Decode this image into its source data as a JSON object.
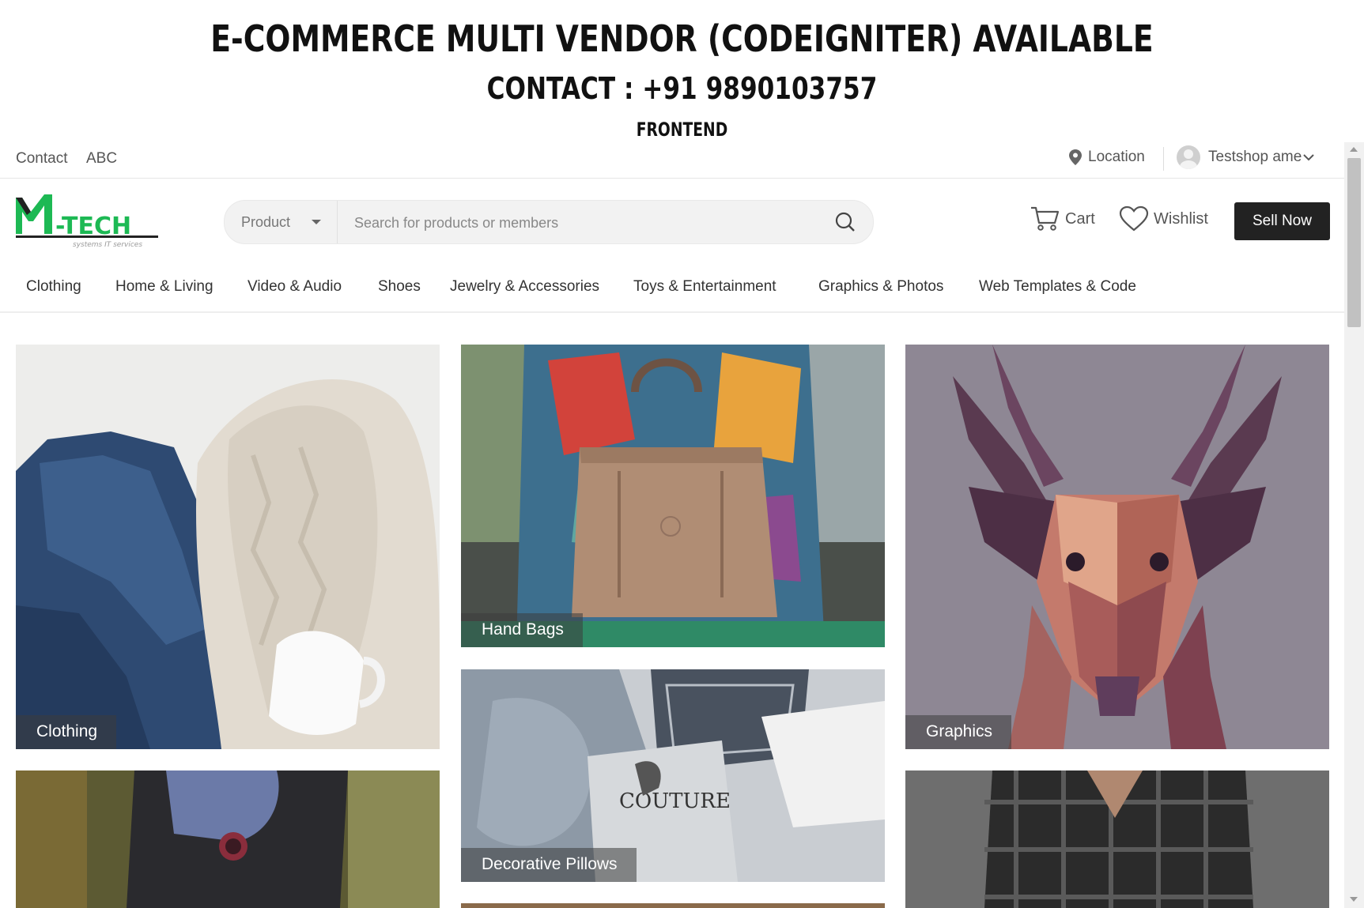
{
  "banner": {
    "title": "E-COMMERCE MULTI VENDOR (CODEIGNITER) AVAILABLE",
    "contact": "CONTACT : +91 9890103757",
    "subtitle": "FRONTEND"
  },
  "topbar": {
    "links": [
      "Contact",
      "ABC"
    ],
    "location_label": "Location",
    "user_name": "Testshop ame"
  },
  "header": {
    "logo_text": "-TECH",
    "logo_tagline": "systems IT services",
    "search_category": "Product",
    "search_placeholder": "Search for products or members",
    "cart_label": "Cart",
    "wishlist_label": "Wishlist",
    "sell_label": "Sell Now"
  },
  "nav": {
    "items": [
      "Clothing",
      "Home & Living",
      "Video & Audio",
      "Shoes",
      "Jewelry & Accessories",
      "Toys & Entertainment",
      "Graphics & Photos",
      "Web Templates & Code"
    ]
  },
  "tiles": [
    {
      "label": "Clothing",
      "icon": "sweater-jeans-photo"
    },
    {
      "label": "Hand Bags",
      "icon": "handbag-photo"
    },
    {
      "label": "Graphics",
      "icon": "polygon-deer-photo"
    },
    {
      "label": "Decorative Pillows",
      "icon": "pillow-photo"
    },
    {
      "label": "",
      "icon": "watch-photo"
    },
    {
      "label": "",
      "icon": "plaid-shirt-photo"
    }
  ],
  "colors": {
    "accent": "#222222",
    "logo_green": "#1db954"
  }
}
